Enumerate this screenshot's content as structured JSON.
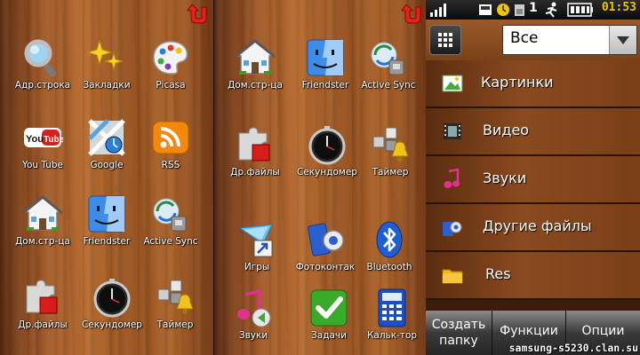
{
  "panel1": {
    "apps": [
      {
        "label": "Адр.строка",
        "icon": "magnifier-icon"
      },
      {
        "label": "Закладки",
        "icon": "stars-icon"
      },
      {
        "label": "Picasa",
        "icon": "palette-icon"
      },
      {
        "label": "You Tube",
        "icon": "youtube-icon"
      },
      {
        "label": "Google",
        "icon": "google-maps-icon"
      },
      {
        "label": "RSS",
        "icon": "rss-icon"
      },
      {
        "label": "Дом.стр-ца",
        "icon": "house-icon"
      },
      {
        "label": "Friendster",
        "icon": "finder-face-icon"
      },
      {
        "label": "Active Sync",
        "icon": "sync-icon"
      },
      {
        "label": "Др.файлы",
        "icon": "puzzle-icon"
      },
      {
        "label": "Секундомер",
        "icon": "stopwatch-icon"
      },
      {
        "label": "Таймер",
        "icon": "timer-bell-icon"
      }
    ]
  },
  "panel2": {
    "apps": [
      {
        "label": "Дом.стр-ца",
        "icon": "house-icon"
      },
      {
        "label": "Friendster",
        "icon": "finder-face-icon"
      },
      {
        "label": "Active Sync",
        "icon": "sync-icon"
      },
      {
        "label": "Др.файлы",
        "icon": "puzzle-icon"
      },
      {
        "label": "Секундомер",
        "icon": "stopwatch-icon"
      },
      {
        "label": "Таймер",
        "icon": "timer-bell-icon"
      },
      {
        "label": "Игры",
        "icon": "games-icon"
      },
      {
        "label": "Фотоконтак",
        "icon": "photocontact-icon"
      },
      {
        "label": "Bluetooth",
        "icon": "bluetooth-icon"
      },
      {
        "label": "Звуки",
        "icon": "music-note-icon"
      },
      {
        "label": "Задачи",
        "icon": "checkmark-icon"
      },
      {
        "label": "Кальк-тор",
        "icon": "calculator-icon"
      }
    ]
  },
  "panel3": {
    "status": {
      "signal": "signal-icon",
      "battery_number": "1",
      "time": "01:53"
    },
    "filter": {
      "selected": "Все"
    },
    "folders": [
      {
        "label": "Картинки",
        "icon": "image-folder-icon"
      },
      {
        "label": "Видео",
        "icon": "video-folder-icon"
      },
      {
        "label": "Звуки",
        "icon": "sound-folder-icon"
      },
      {
        "label": "Другие файлы",
        "icon": "other-files-icon"
      },
      {
        "label": "Res",
        "icon": "folder-icon"
      }
    ],
    "softkeys": {
      "create_line1": "Создать",
      "create_line2": "папку",
      "functions": "Функции",
      "options": "Опции"
    },
    "watermark": "samsung-s5230.clan.su"
  },
  "colors": {
    "clock": "#f1c400",
    "back_arrow": "#e8201a"
  }
}
